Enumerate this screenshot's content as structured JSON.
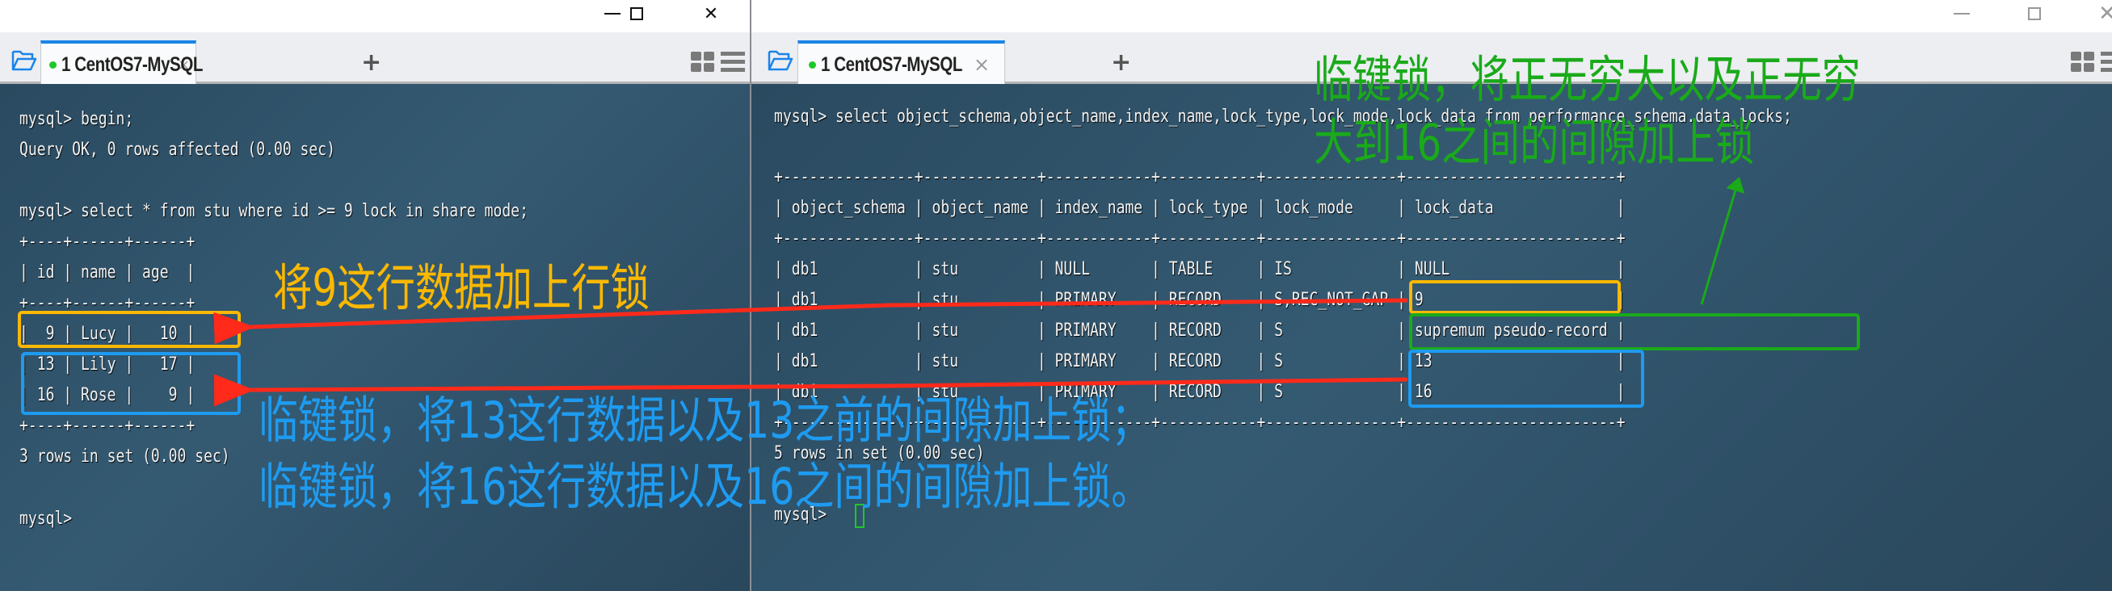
{
  "windows": {
    "left": {
      "tab": {
        "status": "connected",
        "label": "1 CentOS7-MySQL",
        "close": "×"
      },
      "new_tab": "+",
      "controls": {
        "minimize": "minimize",
        "maximize": "maximize",
        "close": "close"
      },
      "terminal_lines": [
        "mysql> begin;",
        "Query OK, 0 rows affected (0.00 sec)",
        "",
        "mysql> select * from stu where id >= 9 lock in share mode;",
        "+----+------+------+",
        "| id | name | age  |",
        "+----+------+------+",
        "|  9 | Lucy |   10 |",
        "| 13 | Lily |   17 |",
        "| 16 | Rose |    9 |",
        "+----+------+------+",
        "3 rows in set (0.00 sec)",
        "",
        "mysql>"
      ],
      "result_table": {
        "columns": [
          "id",
          "name",
          "age"
        ],
        "rows": [
          [
            "9",
            "Lucy",
            "10"
          ],
          [
            "13",
            "Lily",
            "17"
          ],
          [
            "16",
            "Rose",
            "9"
          ]
        ]
      }
    },
    "right": {
      "tab": {
        "status": "connected",
        "label": "1 CentOS7-MySQL",
        "close": "×"
      },
      "new_tab": "+",
      "controls": {
        "minimize": "minimize",
        "maximize": "maximize",
        "close": "close"
      },
      "terminal_lines": [
        "mysql> select object_schema,object_name,index_name,lock_type,lock_mode,lock_data from performance_schema.data_locks;",
        "",
        "+---------------+-------------+------------+-----------+---------------+------------------------+",
        "| object_schema | object_name | index_name | lock_type | lock_mode     | lock_data              |",
        "+---------------+-------------+------------+-----------+---------------+------------------------+",
        "| db1           | stu         | NULL       | TABLE     | IS            | NULL                   |",
        "| db1           | stu         | PRIMARY    | RECORD    | S,REC_NOT_GAP | 9                      |",
        "| db1           | stu         | PRIMARY    | RECORD    | S             | supremum pseudo-record |",
        "| db1           | stu         | PRIMARY    | RECORD    | S             | 13                     |",
        "| db1           | stu         | PRIMARY    | RECORD    | S             | 16                     |",
        "+---------------+-------------+------------+-----------+---------------+------------------------+",
        "5 rows in set (0.00 sec)",
        "",
        "mysql> "
      ],
      "result_table": {
        "columns": [
          "object_schema",
          "object_name",
          "index_name",
          "lock_type",
          "lock_mode",
          "lock_data"
        ],
        "rows": [
          [
            "db1",
            "stu",
            "NULL",
            "TABLE",
            "IS",
            "NULL"
          ],
          [
            "db1",
            "stu",
            "PRIMARY",
            "RECORD",
            "S,REC_NOT_GAP",
            "9"
          ],
          [
            "db1",
            "stu",
            "PRIMARY",
            "RECORD",
            "S",
            "supremum pseudo-record"
          ],
          [
            "db1",
            "stu",
            "PRIMARY",
            "RECORD",
            "S",
            "13"
          ],
          [
            "db1",
            "stu",
            "PRIMARY",
            "RECORD",
            "S",
            "16"
          ]
        ]
      }
    }
  },
  "annotations": {
    "row_lock": {
      "text": "将9这行数据加上行锁",
      "color": "#fbb800"
    },
    "next_key_13": {
      "text": "临键锁，将13这行数据以及13之前的间隙加上锁；",
      "color": "#1e9bf0"
    },
    "next_key_16": {
      "text": "临键锁，将16这行数据以及16之间的间隙加上锁。",
      "color": "#1e9bf0"
    },
    "supremum_line1": {
      "text": "临键锁，将正无穷大以及正无穷",
      "color": "#1aaa1a"
    },
    "supremum_line2": {
      "text": "大到16之间的间隙加上锁",
      "color": "#1aaa1a"
    }
  },
  "arrow_color": "#ff2a1a"
}
